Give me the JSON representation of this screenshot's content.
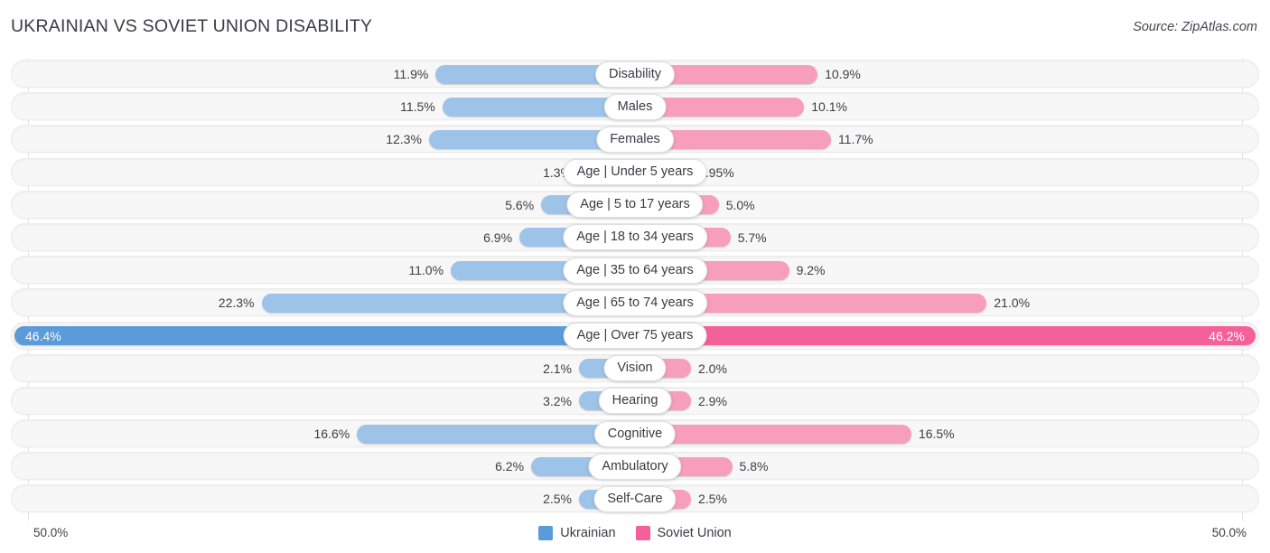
{
  "header": {
    "title": "UKRAINIAN VS SOVIET UNION DISABILITY",
    "source": "Source: ZipAtlas.com"
  },
  "legend": {
    "items": [
      {
        "label": "Ukrainian",
        "color": "#5b9bd9"
      },
      {
        "label": "Soviet Union",
        "color": "#f4609a"
      }
    ]
  },
  "axis": {
    "left_label": "50.0%",
    "right_label": "50.0%"
  },
  "colors": {
    "left_bar": "#9dc3e9",
    "right_bar": "#f79ebc",
    "left_bar_max": "#5b9bd9",
    "right_bar_max": "#f4609a",
    "track": "#f7f7f7",
    "gridline": "#e3e3e6"
  },
  "chart_data": {
    "type": "bar",
    "title": "UKRAINIAN VS SOVIET UNION DISABILITY",
    "subtitle": "Source: ZipAtlas.com",
    "orientation": "horizontal-diverging",
    "xlabel": "",
    "ylabel": "",
    "xlim": [
      50.0,
      50.0
    ],
    "axis_left_max": 50.0,
    "axis_right_max": 50.0,
    "grid": true,
    "legend_position": "bottom-center",
    "categories": [
      "Disability",
      "Males",
      "Females",
      "Age | Under 5 years",
      "Age | 5 to 17 years",
      "Age | 18 to 34 years",
      "Age | 35 to 64 years",
      "Age | 65 to 74 years",
      "Age | Over 75 years",
      "Vision",
      "Hearing",
      "Cognitive",
      "Ambulatory",
      "Self-Care"
    ],
    "series": [
      {
        "name": "Ukrainian",
        "color": "#5b9bd9",
        "values": [
          11.9,
          11.5,
          12.3,
          1.3,
          5.6,
          6.9,
          11.0,
          22.3,
          46.4,
          2.1,
          3.2,
          16.6,
          6.2,
          2.5
        ],
        "labels": [
          "11.9%",
          "11.5%",
          "12.3%",
          "1.3%",
          "5.6%",
          "6.9%",
          "11.0%",
          "22.3%",
          "46.4%",
          "2.1%",
          "3.2%",
          "16.6%",
          "6.2%",
          "2.5%"
        ]
      },
      {
        "name": "Soviet Union",
        "color": "#f4609a",
        "values": [
          10.9,
          10.1,
          11.7,
          0.95,
          5.0,
          5.7,
          9.2,
          21.0,
          46.2,
          2.0,
          2.9,
          16.5,
          5.8,
          2.5
        ],
        "labels": [
          "10.9%",
          "10.1%",
          "11.7%",
          "0.95%",
          "5.0%",
          "5.7%",
          "9.2%",
          "21.0%",
          "46.2%",
          "2.0%",
          "2.9%",
          "16.5%",
          "5.8%",
          "2.5%"
        ]
      }
    ]
  },
  "rows": [
    {
      "label": "Disability",
      "left": 11.9,
      "left_label": "11.9%",
      "right": 10.9,
      "right_label": "10.9%",
      "max": false
    },
    {
      "label": "Males",
      "left": 11.5,
      "left_label": "11.5%",
      "right": 10.1,
      "right_label": "10.1%",
      "max": false
    },
    {
      "label": "Females",
      "left": 12.3,
      "left_label": "12.3%",
      "right": 11.7,
      "right_label": "11.7%",
      "max": false
    },
    {
      "label": "Age | Under 5 years",
      "left": 1.3,
      "left_label": "1.3%",
      "right": 0.95,
      "right_label": "0.95%",
      "max": false
    },
    {
      "label": "Age | 5 to 17 years",
      "left": 5.6,
      "left_label": "5.6%",
      "right": 5.0,
      "right_label": "5.0%",
      "max": false
    },
    {
      "label": "Age | 18 to 34 years",
      "left": 6.9,
      "left_label": "6.9%",
      "right": 5.7,
      "right_label": "5.7%",
      "max": false
    },
    {
      "label": "Age | 35 to 64 years",
      "left": 11.0,
      "left_label": "11.0%",
      "right": 9.2,
      "right_label": "9.2%",
      "max": false
    },
    {
      "label": "Age | 65 to 74 years",
      "left": 22.3,
      "left_label": "22.3%",
      "right": 21.0,
      "right_label": "21.0%",
      "max": false
    },
    {
      "label": "Age | Over 75 years",
      "left": 46.4,
      "left_label": "46.4%",
      "right": 46.2,
      "right_label": "46.2%",
      "max": true
    },
    {
      "label": "Vision",
      "left": 2.1,
      "left_label": "2.1%",
      "right": 2.0,
      "right_label": "2.0%",
      "max": false
    },
    {
      "label": "Hearing",
      "left": 3.2,
      "left_label": "3.2%",
      "right": 2.9,
      "right_label": "2.9%",
      "max": false
    },
    {
      "label": "Cognitive",
      "left": 16.6,
      "left_label": "16.6%",
      "right": 16.5,
      "right_label": "16.5%",
      "max": false
    },
    {
      "label": "Ambulatory",
      "left": 6.2,
      "left_label": "6.2%",
      "right": 5.8,
      "right_label": "5.8%",
      "max": false
    },
    {
      "label": "Self-Care",
      "left": 2.5,
      "left_label": "2.5%",
      "right": 2.5,
      "right_label": "2.5%",
      "max": false
    }
  ]
}
